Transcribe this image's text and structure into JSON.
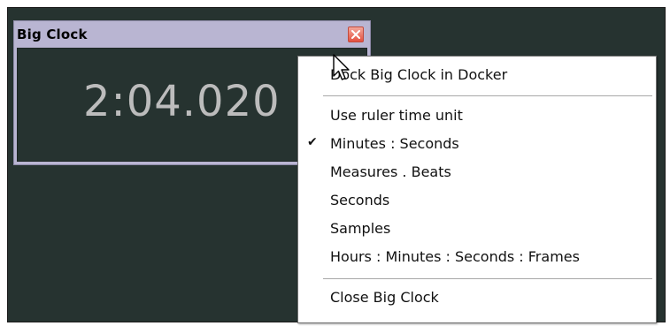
{
  "window": {
    "title": "Big Clock",
    "time": "2:04.020"
  },
  "icons": {
    "close": "close-icon",
    "check": "checkmark-icon",
    "cursor": "mouse-pointer-icon"
  },
  "colors": {
    "background": "#263330",
    "clock_text": "#bcbcbc",
    "title_bar": "#b9b5d2",
    "close_button": "#e4503f"
  },
  "menu": {
    "dock": "Dock Big Clock in Docker",
    "use_ruler": "Use ruler time unit",
    "minutes_seconds": "Minutes : Seconds",
    "check_mark": "✔",
    "measures_beats": "Measures . Beats",
    "seconds": "Seconds",
    "samples": "Samples",
    "hmsf": "Hours : Minutes : Seconds : Frames",
    "close": "Close Big Clock"
  }
}
